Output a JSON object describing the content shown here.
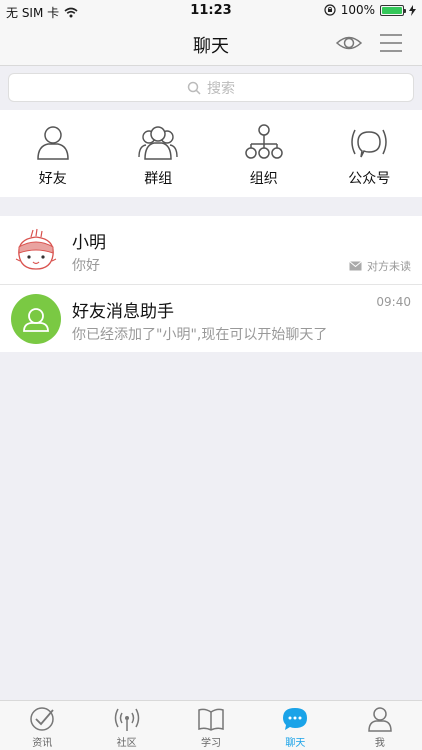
{
  "status_bar": {
    "carrier": "无 SIM 卡",
    "time": "11:23",
    "battery": "100%",
    "battery_level": 1.0
  },
  "nav": {
    "title": "聊天",
    "eye_icon": "eye-icon",
    "menu_icon": "menu-icon"
  },
  "search": {
    "placeholder": "搜索"
  },
  "quick_entries": [
    {
      "label": "好友",
      "icon": "person-icon"
    },
    {
      "label": "群组",
      "icon": "group-icon"
    },
    {
      "label": "组织",
      "icon": "org-chart-icon"
    },
    {
      "label": "公众号",
      "icon": "broadcast-icon"
    }
  ],
  "chats": [
    {
      "name": "小明",
      "message": "你好",
      "status": "对方未读",
      "time": ""
    },
    {
      "name": "好友消息助手",
      "message": "你已经添加了\"小明\",现在可以开始聊天了",
      "status": "",
      "time": "09:40"
    }
  ],
  "tabs": [
    {
      "label": "资讯",
      "icon": "check-circle-icon",
      "active": false
    },
    {
      "label": "社区",
      "icon": "antenna-icon",
      "active": false
    },
    {
      "label": "学习",
      "icon": "book-icon",
      "active": false
    },
    {
      "label": "聊天",
      "icon": "chat-bubble-icon",
      "active": true
    },
    {
      "label": "我",
      "icon": "user-icon",
      "active": false
    }
  ],
  "colors": {
    "accent": "#1aa3e8",
    "assistant_avatar": "#7ac943",
    "battery_green": "#34c759"
  }
}
